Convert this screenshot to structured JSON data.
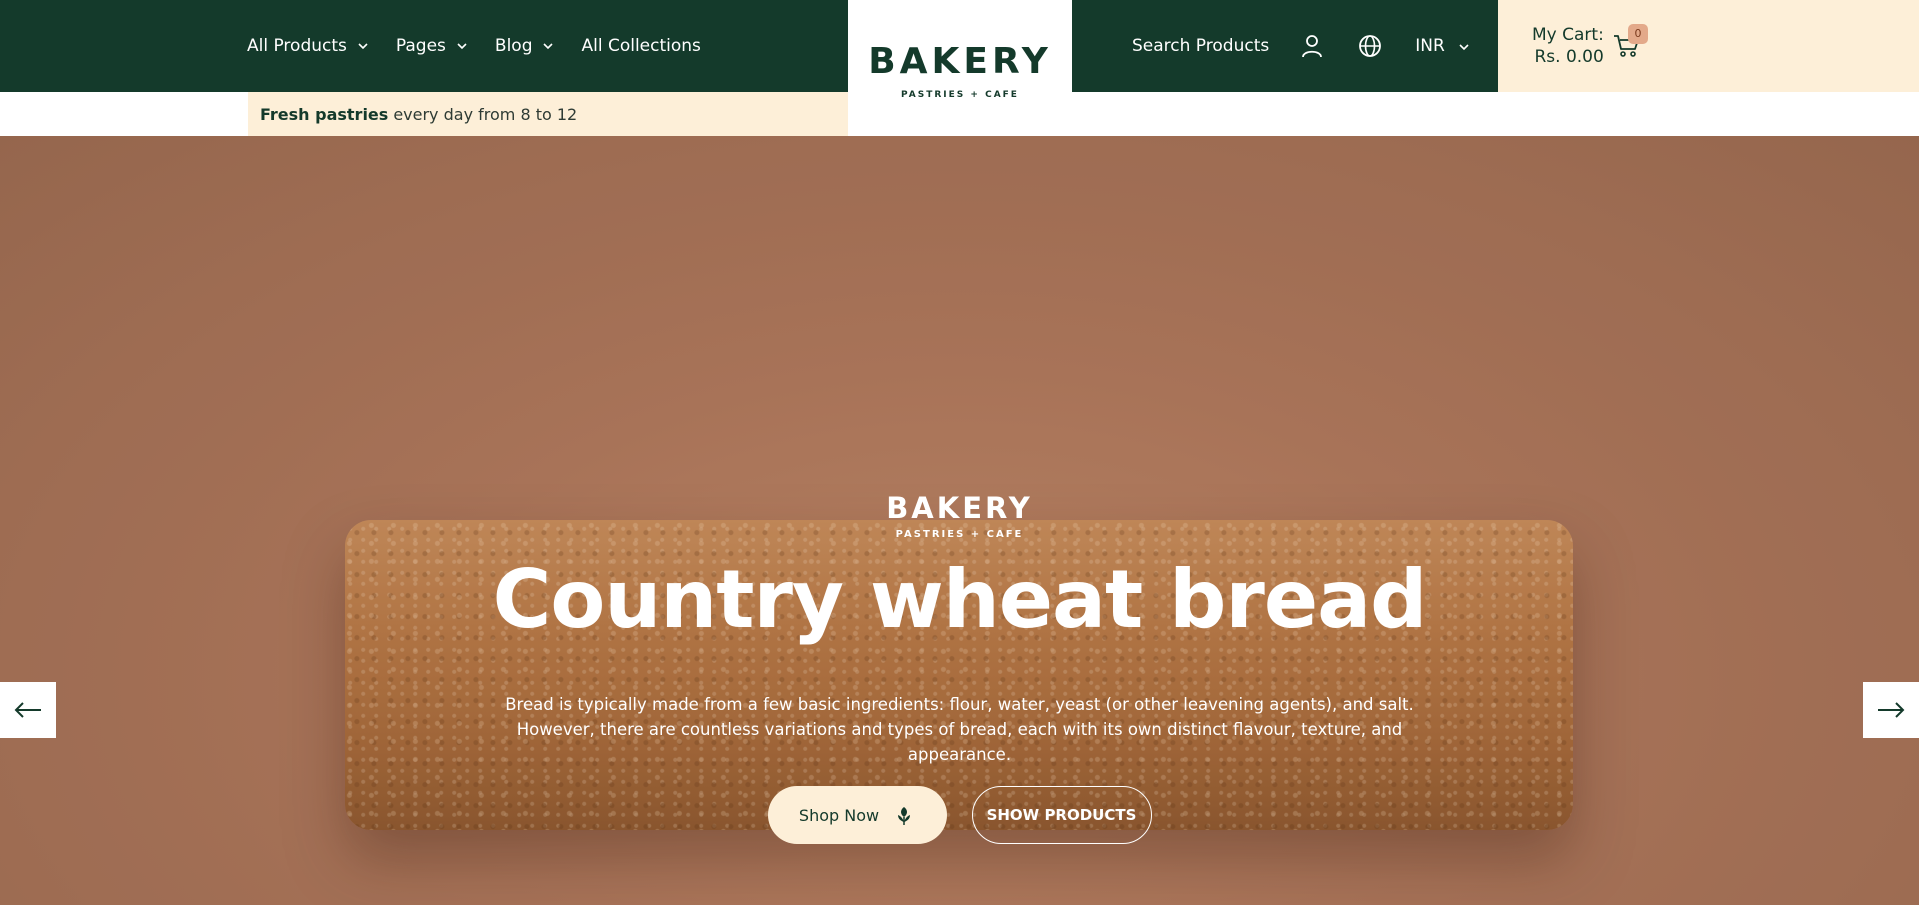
{
  "header": {
    "nav": [
      {
        "label": "All Products",
        "has_dropdown": true
      },
      {
        "label": "Pages",
        "has_dropdown": true
      },
      {
        "label": "Blog",
        "has_dropdown": true
      },
      {
        "label": "All Collections",
        "has_dropdown": false
      }
    ],
    "logo": {
      "main": "BAKERY",
      "sub": "PASTRIES + CAFE"
    },
    "search_label": "Search Products",
    "account_icon": "user-icon",
    "language_icon": "globe-icon",
    "currency": "INR",
    "cart": {
      "label": "My Cart:",
      "total": "Rs. 0.00",
      "count": "0",
      "icon": "cart-icon"
    }
  },
  "promo": {
    "bold": "Fresh pastries",
    "text": "every day from 8 to 12"
  },
  "hero": {
    "logo_main": "BAKERY",
    "logo_sub": "PASTRIES + CAFE",
    "title": "Country wheat bread",
    "description": "Bread is typically made from a few basic ingredients: flour, water, yeast (or other leavening agents), and salt. However, there are countless variations and types of bread, each with its own distinct flavour, texture, and appearance.",
    "primary_button": "Shop Now",
    "secondary_button": "SHOW PRODUCTS",
    "prev_icon": "arrow-left-icon",
    "next_icon": "arrow-right-icon"
  },
  "colors": {
    "header_bg": "#143a2b",
    "cream": "#fdefd8",
    "badge": "#e3a98a",
    "hero_bg": "#b07a5e"
  }
}
